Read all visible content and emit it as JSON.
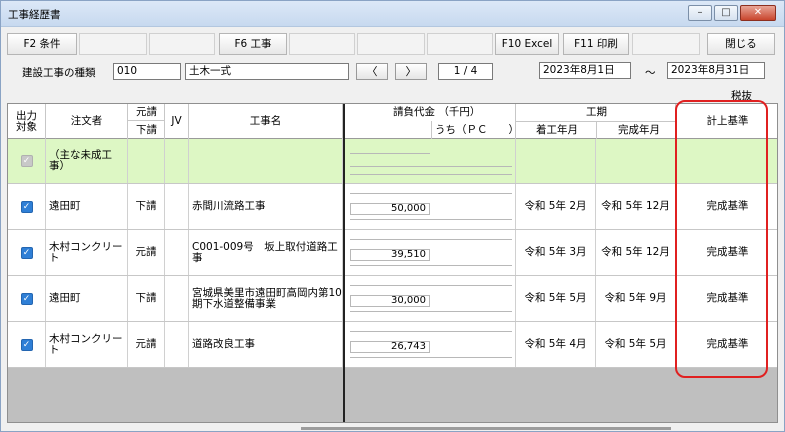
{
  "window": {
    "title": "工事経歴書",
    "controls": [
      "–",
      "□",
      "✕"
    ]
  },
  "fkeys": {
    "f2": "F2 条件",
    "f6": "F6 工事",
    "f10": "F10 Excel",
    "f11": "F11 印刷",
    "close": "閉じる"
  },
  "conditions": {
    "type_label": "建設工事の種類",
    "type_code": "010",
    "type_name": "土木一式",
    "prev": "〈",
    "next": "〉",
    "page": "1 / 4",
    "date_from": "2023年8月1日",
    "tilde": "～",
    "date_to": "2023年8月31日",
    "tax": "税抜"
  },
  "table": {
    "headers": {
      "output": "出力\n対象",
      "orderer": "注文者",
      "contract_top": "元請",
      "contract_bottom": "下請",
      "jv": "JV",
      "name": "工事名",
      "amount": "請負代金 （千円）",
      "amount_pc": "うち（ＰＣ　　）",
      "period": "工期",
      "start": "着工年月",
      "end": "完成年月",
      "basis": "計上基準"
    },
    "summary_row": "（主な未成工事）",
    "rows": [
      {
        "orderer": "遠田町",
        "contract": "下請",
        "name": "赤間川流路工事",
        "amount": "50,000",
        "start": "令和 5年 2月",
        "end": "令和 5年 12月",
        "basis": "完成基準"
      },
      {
        "orderer": "木村コンクリート",
        "contract": "元請",
        "name": "C001-009号　坂上取付道路工事",
        "amount": "39,510",
        "start": "令和 5年 3月",
        "end": "令和 5年 12月",
        "basis": "完成基準"
      },
      {
        "orderer": "遠田町",
        "contract": "下請",
        "name": "宮城県美里市遠田町高岡内第10期下水道整備事業",
        "amount": "30,000",
        "start": "令和 5年 5月",
        "end": "令和 5年 9月",
        "basis": "完成基準"
      },
      {
        "orderer": "木村コンクリート",
        "contract": "元請",
        "name": "道路改良工事",
        "amount": "26,743",
        "start": "令和 5年 4月",
        "end": "令和 5年 5月",
        "basis": "完成基準"
      }
    ]
  }
}
